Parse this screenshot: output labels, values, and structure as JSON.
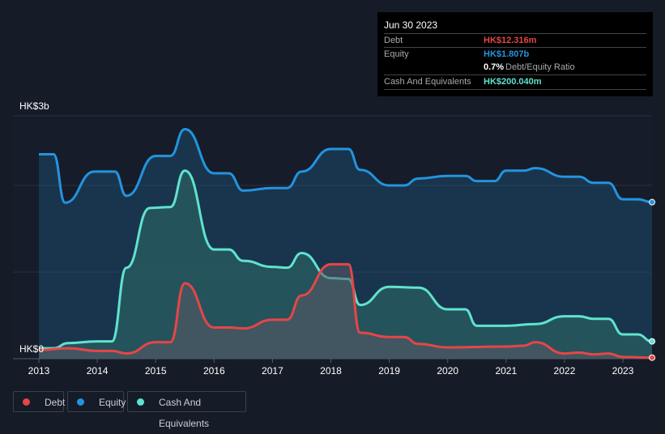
{
  "tooltip": {
    "date": "Jun 30 2023",
    "debt_label": "Debt",
    "debt_value": "HK$12.316m",
    "equity_label": "Equity",
    "equity_value": "HK$1.807b",
    "ratio_value": "0.7%",
    "ratio_label": "Debt/Equity Ratio",
    "cash_label": "Cash And Equivalents",
    "cash_value": "HK$200.040m"
  },
  "legend": [
    {
      "label": "Debt",
      "color": "#e64646"
    },
    {
      "label": "Equity",
      "color": "#2394df"
    },
    {
      "label": "Cash And Equivalents",
      "color": "#5fe3cf"
    }
  ],
  "chart_data": {
    "type": "area",
    "y_tick_labels": [
      "HK$0",
      "HK$3b"
    ],
    "x_tick_labels": [
      "2013",
      "2014",
      "2015",
      "2016",
      "2017",
      "2018",
      "2019",
      "2020",
      "2021",
      "2022",
      "2023"
    ],
    "xlim": [
      2012.6,
      2023.5
    ],
    "ylim": [
      0,
      2.8
    ],
    "y_unit": "HK$ billions",
    "grid": true,
    "series": [
      {
        "name": "Equity",
        "color": "#2394df",
        "points": [
          [
            2013,
            2.36
          ],
          [
            2013.25,
            2.36
          ],
          [
            2013.45,
            1.8
          ],
          [
            2013.95,
            2.16
          ],
          [
            2014.3,
            2.16
          ],
          [
            2014.5,
            1.88
          ],
          [
            2015,
            2.34
          ],
          [
            2015.25,
            2.34
          ],
          [
            2015.5,
            2.65
          ],
          [
            2016,
            2.14
          ],
          [
            2016.25,
            2.14
          ],
          [
            2016.5,
            1.94
          ],
          [
            2017,
            1.97
          ],
          [
            2017.25,
            1.97
          ],
          [
            2017.5,
            2.16
          ],
          [
            2018,
            2.42
          ],
          [
            2018.3,
            2.42
          ],
          [
            2018.5,
            2.18
          ],
          [
            2019,
            2.0
          ],
          [
            2019.25,
            2.0
          ],
          [
            2019.5,
            2.08
          ],
          [
            2020,
            2.11
          ],
          [
            2020.3,
            2.11
          ],
          [
            2020.5,
            2.05
          ],
          [
            2020.8,
            2.05
          ],
          [
            2021,
            2.17
          ],
          [
            2021.3,
            2.17
          ],
          [
            2021.5,
            2.2
          ],
          [
            2022,
            2.1
          ],
          [
            2022.25,
            2.1
          ],
          [
            2022.5,
            2.03
          ],
          [
            2022.75,
            2.03
          ],
          [
            2023,
            1.84
          ],
          [
            2023.25,
            1.84
          ],
          [
            2023.5,
            1.807
          ]
        ]
      },
      {
        "name": "Cash And Equivalents",
        "color": "#5fe3cf",
        "points": [
          [
            2013,
            0.12
          ],
          [
            2013.25,
            0.12
          ],
          [
            2013.5,
            0.18
          ],
          [
            2014,
            0.2
          ],
          [
            2014.25,
            0.2
          ],
          [
            2014.5,
            1.05
          ],
          [
            2014.9,
            1.74
          ],
          [
            2015.25,
            1.75
          ],
          [
            2015.5,
            2.17
          ],
          [
            2016,
            1.26
          ],
          [
            2016.25,
            1.26
          ],
          [
            2016.5,
            1.13
          ],
          [
            2017,
            1.06
          ],
          [
            2017.25,
            1.05
          ],
          [
            2017.5,
            1.22
          ],
          [
            2018,
            0.93
          ],
          [
            2018.3,
            0.92
          ],
          [
            2018.5,
            0.62
          ],
          [
            2019,
            0.83
          ],
          [
            2019.5,
            0.82
          ],
          [
            2020,
            0.57
          ],
          [
            2020.3,
            0.57
          ],
          [
            2020.5,
            0.38
          ],
          [
            2021,
            0.38
          ],
          [
            2021.5,
            0.4
          ],
          [
            2022,
            0.49
          ],
          [
            2022.25,
            0.49
          ],
          [
            2022.5,
            0.46
          ],
          [
            2022.75,
            0.46
          ],
          [
            2023,
            0.28
          ],
          [
            2023.25,
            0.28
          ],
          [
            2023.5,
            0.2
          ]
        ]
      },
      {
        "name": "Debt",
        "color": "#e64646",
        "points": [
          [
            2013,
            0.1
          ],
          [
            2013.5,
            0.12
          ],
          [
            2014,
            0.09
          ],
          [
            2014.25,
            0.09
          ],
          [
            2014.5,
            0.06
          ],
          [
            2015,
            0.19
          ],
          [
            2015.25,
            0.19
          ],
          [
            2015.5,
            0.87
          ],
          [
            2016,
            0.36
          ],
          [
            2016.25,
            0.36
          ],
          [
            2016.5,
            0.35
          ],
          [
            2017,
            0.45
          ],
          [
            2017.25,
            0.45
          ],
          [
            2017.5,
            0.73
          ],
          [
            2018,
            1.09
          ],
          [
            2018.3,
            1.09
          ],
          [
            2018.5,
            0.3
          ],
          [
            2019,
            0.25
          ],
          [
            2019.25,
            0.25
          ],
          [
            2019.5,
            0.17
          ],
          [
            2020,
            0.13
          ],
          [
            2021,
            0.14
          ],
          [
            2021.3,
            0.15
          ],
          [
            2021.5,
            0.19
          ],
          [
            2022,
            0.06
          ],
          [
            2022.25,
            0.07
          ],
          [
            2022.5,
            0.05
          ],
          [
            2022.75,
            0.06
          ],
          [
            2023,
            0.02
          ],
          [
            2023.5,
            0.012
          ]
        ]
      }
    ]
  }
}
